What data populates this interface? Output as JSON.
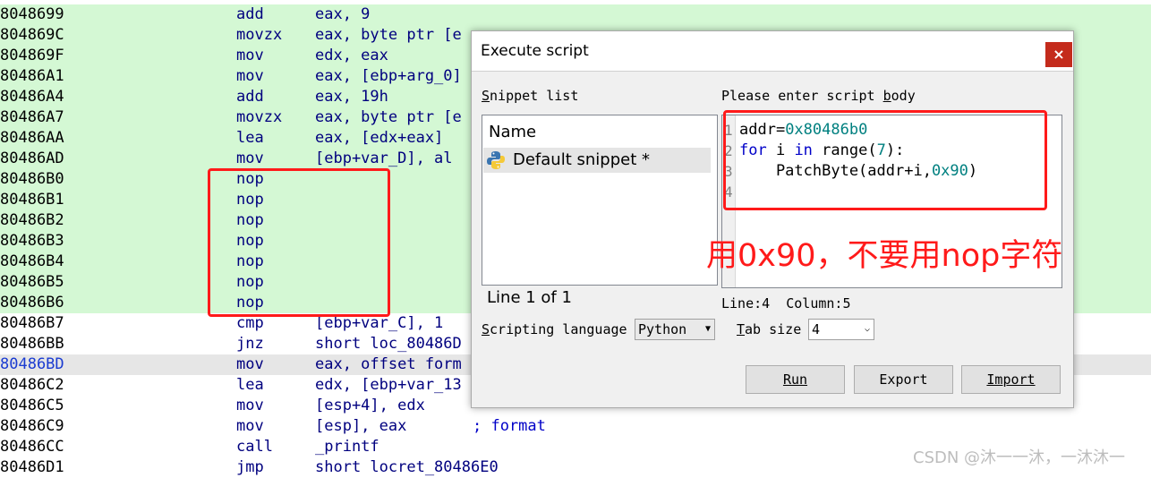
{
  "asm_rows": [
    {
      "addr": "8048699",
      "mnem": "add",
      "op": "eax, 9",
      "comment": ""
    },
    {
      "addr": "804869C",
      "mnem": "movzx",
      "op": "eax, byte ptr [e",
      "comment": ""
    },
    {
      "addr": "804869F",
      "mnem": "mov",
      "op": "edx, eax",
      "comment": ""
    },
    {
      "addr": "80486A1",
      "mnem": "mov",
      "op": "eax, [ebp+arg_0]",
      "comment": ""
    },
    {
      "addr": "80486A4",
      "mnem": "add",
      "op": "eax, 19h",
      "comment": ""
    },
    {
      "addr": "80486A7",
      "mnem": "movzx",
      "op": "eax, byte ptr [e",
      "comment": ""
    },
    {
      "addr": "80486AA",
      "mnem": "lea",
      "op": "eax, [edx+eax]",
      "comment": ""
    },
    {
      "addr": "80486AD",
      "mnem": "mov",
      "op": "[ebp+var_D], al",
      "comment": ""
    },
    {
      "addr": "80486B0",
      "mnem": "nop",
      "op": "",
      "comment": ""
    },
    {
      "addr": "80486B1",
      "mnem": "nop",
      "op": "",
      "comment": ""
    },
    {
      "addr": "80486B2",
      "mnem": "nop",
      "op": "",
      "comment": ""
    },
    {
      "addr": "80486B3",
      "mnem": "nop",
      "op": "",
      "comment": ""
    },
    {
      "addr": "80486B4",
      "mnem": "nop",
      "op": "",
      "comment": ""
    },
    {
      "addr": "80486B5",
      "mnem": "nop",
      "op": "",
      "comment": ""
    },
    {
      "addr": "80486B6",
      "mnem": "nop",
      "op": "",
      "comment": ""
    },
    {
      "addr": "80486B7",
      "mnem": "cmp",
      "op": "[ebp+var_C], 1",
      "comment": ""
    },
    {
      "addr": "80486BB",
      "mnem": "jnz",
      "op": "short loc_80486D",
      "comment": ""
    },
    {
      "addr": "80486BD",
      "mnem": "mov",
      "op": "eax, offset form",
      "comment": ""
    },
    {
      "addr": "80486C2",
      "mnem": "lea",
      "op": "edx, [ebp+var_13",
      "comment": ""
    },
    {
      "addr": "80486C5",
      "mnem": "mov",
      "op": "[esp+4], edx",
      "comment": ""
    },
    {
      "addr": "80486C9",
      "mnem": "mov",
      "op": "[esp], eax",
      "comment": "; format"
    },
    {
      "addr": "80486CC",
      "mnem": "call",
      "op": "_printf",
      "comment": ""
    },
    {
      "addr": "80486D1",
      "mnem": "jmp",
      "op": "short locret_80486E0",
      "comment": ""
    }
  ],
  "dialog": {
    "title": "Execute script",
    "close_glyph": "×",
    "snippet_list_label": "Snippet list",
    "snippet_list_label_underline": "S",
    "snippet_list_label_rest": "nippet list",
    "column_name": "Name",
    "snippet_item": "Default snippet *",
    "line_of": "Line 1 of 1",
    "script_body_label_pre": "Please enter script ",
    "script_body_label_underline": "b",
    "script_body_label_post": "ody",
    "code_lines": [
      "addr=0x80486b0",
      "for i in range(7):",
      "    PatchByte(addr+i,0x90)",
      ""
    ],
    "status": "Line:4  Column:5",
    "lang_label_underline": "S",
    "lang_label_rest": "cripting language",
    "lang_value": "Python",
    "tab_label_underline": "T",
    "tab_label_rest": "ab size",
    "tab_value": "4",
    "buttons": {
      "run": "Run",
      "export": "Export",
      "import": "Import"
    }
  },
  "annotation": "用0x90，不要用nop字符",
  "watermark": "CSDN @沐一一沐，一沐沐一",
  "colors": {
    "highlight_green": "#d4f8d4",
    "annotation_red": "#ff1a1a",
    "selected_row": "#e6e6e6"
  }
}
